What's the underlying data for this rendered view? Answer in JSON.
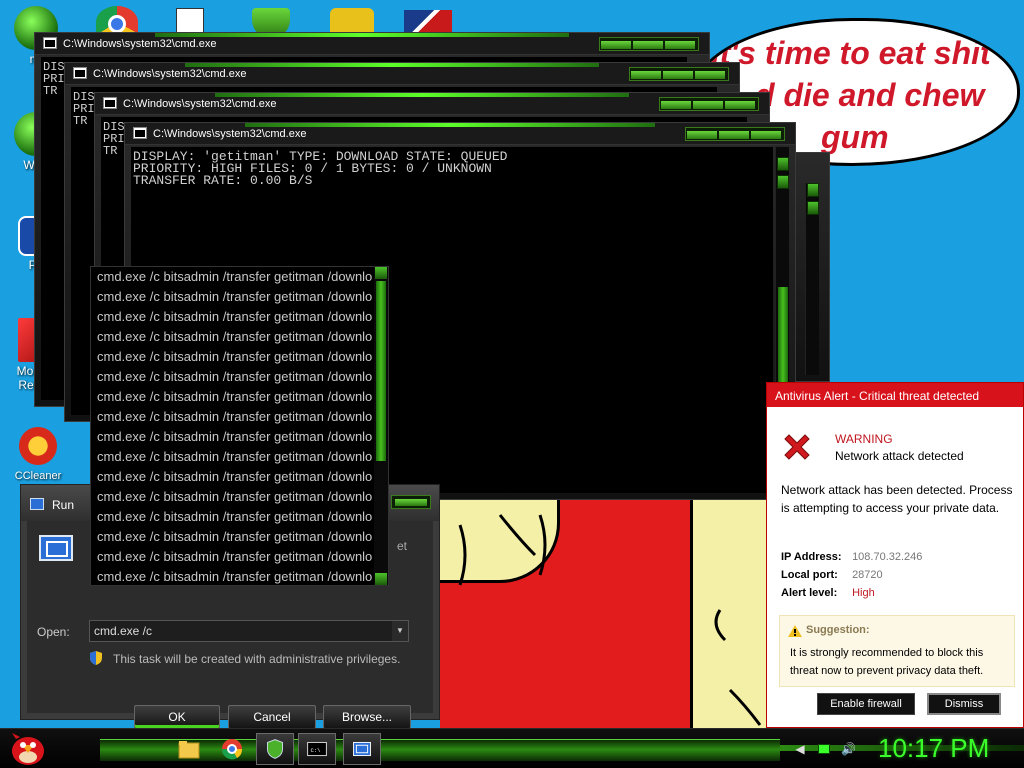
{
  "desktop": {
    "icons": [
      {
        "label": "mi",
        "name": "desktop-icon-1"
      },
      {
        "label": "Wi V",
        "name": "desktop-icon-2"
      },
      {
        "label": "Po",
        "name": "desktop-icon-3"
      },
      {
        "label": "Morbius Reader",
        "name": "desktop-icon-morbius-reader"
      },
      {
        "label": "CCleaner",
        "name": "desktop-icon-ccleaner"
      }
    ],
    "top_icons": [
      "chrome-icon",
      "solitaire-icon",
      "shield-icon",
      "angry-birds-icon",
      "flag-icon"
    ]
  },
  "bubble": {
    "line1": "it's time to eat shit",
    "line2": "d die and chew",
    "line3": "gum"
  },
  "cmd": {
    "window_title": "C:\\Windows\\system32\\cmd.exe",
    "partial_lines": [
      "DIS",
      "PRI",
      "TR"
    ],
    "front_output": "DISPLAY: 'getitman' TYPE: DOWNLOAD STATE: QUEUED\nPRIORITY: HIGH FILES: 0 / 1 BYTES: 0 / UNKNOWN\nTRANSFER RATE: 0.00 B/S"
  },
  "autocomplete": {
    "item_text": "cmd.exe /c bitsadmin /transfer getitman /downlo",
    "count": 16
  },
  "run_dialog": {
    "title": "Run",
    "ghost_text": "et",
    "open_label": "Open:",
    "open_value": "cmd.exe /c",
    "admin_message": "This task will be created with administrative privileges.",
    "ok_label": "OK",
    "cancel_label": "Cancel",
    "browse_label": "Browse..."
  },
  "antivirus": {
    "title": "Antivirus Alert - Critical threat detected",
    "warning": "WARNING",
    "warning_sub": "Network attack detected",
    "description": "Network attack has been detected. Process is attempting to access your private data.",
    "ip_label": "IP Address:",
    "ip_value": "108.70.32.246",
    "port_label": "Local port:",
    "port_value": "28720",
    "level_label": "Alert level:",
    "level_value": "High",
    "suggestion_title": "Suggestion:",
    "suggestion_text": "It is strongly recommended to block this threat now to prevent privacy data theft.",
    "enable_label": "Enable firewall",
    "dismiss_label": "Dismiss"
  },
  "taskbar": {
    "clock": "10:17 PM"
  },
  "colors": {
    "desktop_bg": "#1aa0e0",
    "accent_green": "#3bff2b",
    "alert_red": "#d7121b"
  }
}
